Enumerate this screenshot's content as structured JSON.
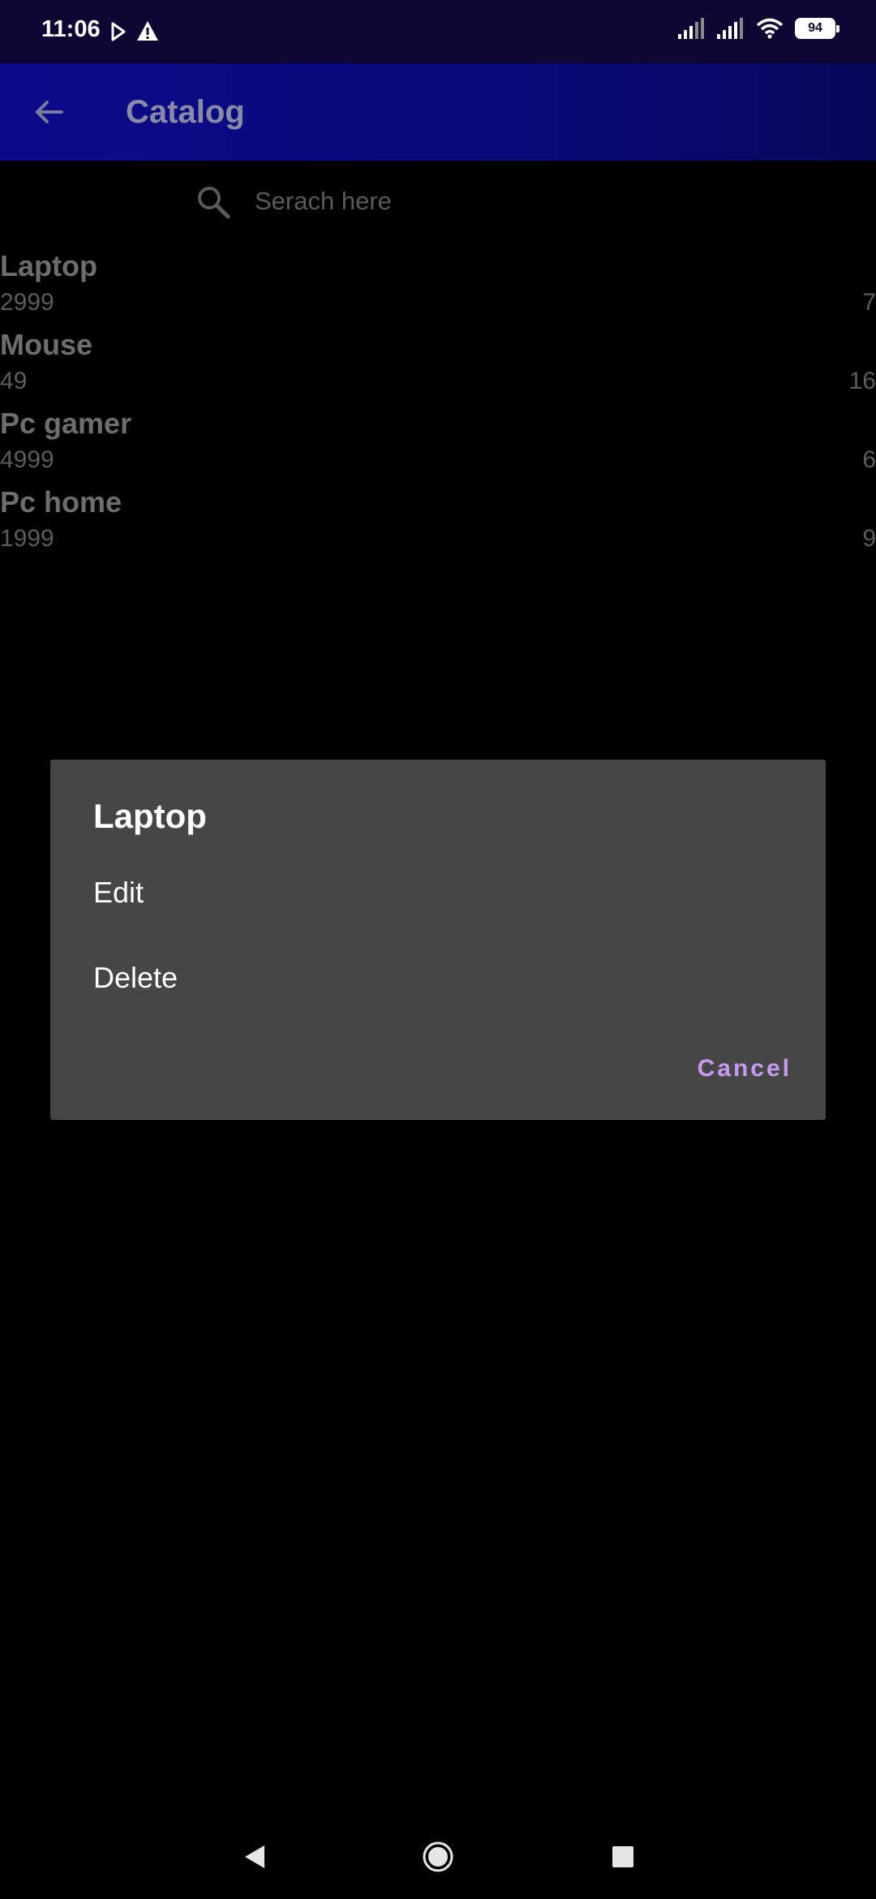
{
  "status_bar": {
    "time": "11:06",
    "battery": "94"
  },
  "app_bar": {
    "title": "Catalog"
  },
  "search": {
    "placeholder": "Serach here"
  },
  "products": [
    {
      "name": "Laptop",
      "price": "2999",
      "qty": "7"
    },
    {
      "name": "Mouse",
      "price": "49",
      "qty": "16"
    },
    {
      "name": "Pc gamer",
      "price": "4999",
      "qty": "6"
    },
    {
      "name": "Pc home",
      "price": "1999",
      "qty": "9"
    }
  ],
  "dialog": {
    "title": "Laptop",
    "options": [
      "Edit",
      "Delete"
    ],
    "cancel_label": "Cancel"
  },
  "colors": {
    "status_bar_bg": "#0e0733",
    "app_bar_bg": "#0b0b8a",
    "dialog_bg": "#464646",
    "accent": "#c79af2"
  }
}
